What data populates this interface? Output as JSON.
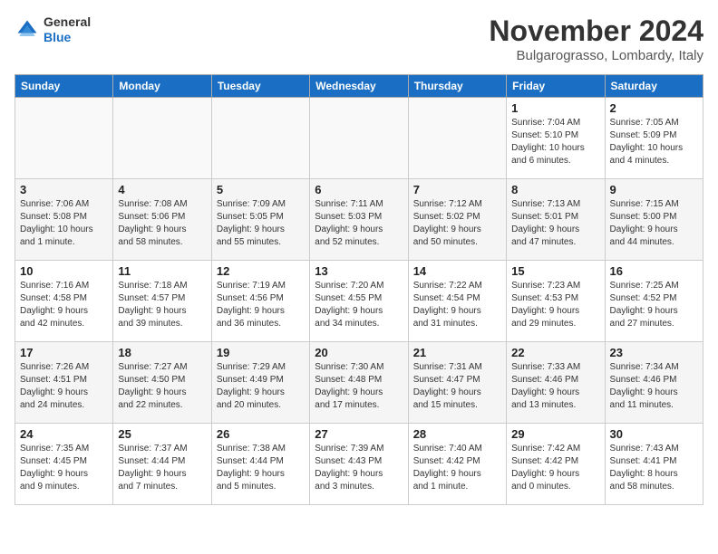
{
  "header": {
    "logo_line1": "General",
    "logo_line2": "Blue",
    "month_title": "November 2024",
    "location": "Bulgarograsso, Lombardy, Italy"
  },
  "weekdays": [
    "Sunday",
    "Monday",
    "Tuesday",
    "Wednesday",
    "Thursday",
    "Friday",
    "Saturday"
  ],
  "weeks": [
    {
      "shaded": false,
      "days": [
        {
          "num": "",
          "info": "",
          "empty": true
        },
        {
          "num": "",
          "info": "",
          "empty": true
        },
        {
          "num": "",
          "info": "",
          "empty": true
        },
        {
          "num": "",
          "info": "",
          "empty": true
        },
        {
          "num": "",
          "info": "",
          "empty": true
        },
        {
          "num": "1",
          "info": "Sunrise: 7:04 AM\nSunset: 5:10 PM\nDaylight: 10 hours\nand 6 minutes.",
          "empty": false
        },
        {
          "num": "2",
          "info": "Sunrise: 7:05 AM\nSunset: 5:09 PM\nDaylight: 10 hours\nand 4 minutes.",
          "empty": false
        }
      ]
    },
    {
      "shaded": true,
      "days": [
        {
          "num": "3",
          "info": "Sunrise: 7:06 AM\nSunset: 5:08 PM\nDaylight: 10 hours\nand 1 minute.",
          "empty": false
        },
        {
          "num": "4",
          "info": "Sunrise: 7:08 AM\nSunset: 5:06 PM\nDaylight: 9 hours\nand 58 minutes.",
          "empty": false
        },
        {
          "num": "5",
          "info": "Sunrise: 7:09 AM\nSunset: 5:05 PM\nDaylight: 9 hours\nand 55 minutes.",
          "empty": false
        },
        {
          "num": "6",
          "info": "Sunrise: 7:11 AM\nSunset: 5:03 PM\nDaylight: 9 hours\nand 52 minutes.",
          "empty": false
        },
        {
          "num": "7",
          "info": "Sunrise: 7:12 AM\nSunset: 5:02 PM\nDaylight: 9 hours\nand 50 minutes.",
          "empty": false
        },
        {
          "num": "8",
          "info": "Sunrise: 7:13 AM\nSunset: 5:01 PM\nDaylight: 9 hours\nand 47 minutes.",
          "empty": false
        },
        {
          "num": "9",
          "info": "Sunrise: 7:15 AM\nSunset: 5:00 PM\nDaylight: 9 hours\nand 44 minutes.",
          "empty": false
        }
      ]
    },
    {
      "shaded": false,
      "days": [
        {
          "num": "10",
          "info": "Sunrise: 7:16 AM\nSunset: 4:58 PM\nDaylight: 9 hours\nand 42 minutes.",
          "empty": false
        },
        {
          "num": "11",
          "info": "Sunrise: 7:18 AM\nSunset: 4:57 PM\nDaylight: 9 hours\nand 39 minutes.",
          "empty": false
        },
        {
          "num": "12",
          "info": "Sunrise: 7:19 AM\nSunset: 4:56 PM\nDaylight: 9 hours\nand 36 minutes.",
          "empty": false
        },
        {
          "num": "13",
          "info": "Sunrise: 7:20 AM\nSunset: 4:55 PM\nDaylight: 9 hours\nand 34 minutes.",
          "empty": false
        },
        {
          "num": "14",
          "info": "Sunrise: 7:22 AM\nSunset: 4:54 PM\nDaylight: 9 hours\nand 31 minutes.",
          "empty": false
        },
        {
          "num": "15",
          "info": "Sunrise: 7:23 AM\nSunset: 4:53 PM\nDaylight: 9 hours\nand 29 minutes.",
          "empty": false
        },
        {
          "num": "16",
          "info": "Sunrise: 7:25 AM\nSunset: 4:52 PM\nDaylight: 9 hours\nand 27 minutes.",
          "empty": false
        }
      ]
    },
    {
      "shaded": true,
      "days": [
        {
          "num": "17",
          "info": "Sunrise: 7:26 AM\nSunset: 4:51 PM\nDaylight: 9 hours\nand 24 minutes.",
          "empty": false
        },
        {
          "num": "18",
          "info": "Sunrise: 7:27 AM\nSunset: 4:50 PM\nDaylight: 9 hours\nand 22 minutes.",
          "empty": false
        },
        {
          "num": "19",
          "info": "Sunrise: 7:29 AM\nSunset: 4:49 PM\nDaylight: 9 hours\nand 20 minutes.",
          "empty": false
        },
        {
          "num": "20",
          "info": "Sunrise: 7:30 AM\nSunset: 4:48 PM\nDaylight: 9 hours\nand 17 minutes.",
          "empty": false
        },
        {
          "num": "21",
          "info": "Sunrise: 7:31 AM\nSunset: 4:47 PM\nDaylight: 9 hours\nand 15 minutes.",
          "empty": false
        },
        {
          "num": "22",
          "info": "Sunrise: 7:33 AM\nSunset: 4:46 PM\nDaylight: 9 hours\nand 13 minutes.",
          "empty": false
        },
        {
          "num": "23",
          "info": "Sunrise: 7:34 AM\nSunset: 4:46 PM\nDaylight: 9 hours\nand 11 minutes.",
          "empty": false
        }
      ]
    },
    {
      "shaded": false,
      "days": [
        {
          "num": "24",
          "info": "Sunrise: 7:35 AM\nSunset: 4:45 PM\nDaylight: 9 hours\nand 9 minutes.",
          "empty": false
        },
        {
          "num": "25",
          "info": "Sunrise: 7:37 AM\nSunset: 4:44 PM\nDaylight: 9 hours\nand 7 minutes.",
          "empty": false
        },
        {
          "num": "26",
          "info": "Sunrise: 7:38 AM\nSunset: 4:44 PM\nDaylight: 9 hours\nand 5 minutes.",
          "empty": false
        },
        {
          "num": "27",
          "info": "Sunrise: 7:39 AM\nSunset: 4:43 PM\nDaylight: 9 hours\nand 3 minutes.",
          "empty": false
        },
        {
          "num": "28",
          "info": "Sunrise: 7:40 AM\nSunset: 4:42 PM\nDaylight: 9 hours\nand 1 minute.",
          "empty": false
        },
        {
          "num": "29",
          "info": "Sunrise: 7:42 AM\nSunset: 4:42 PM\nDaylight: 9 hours\nand 0 minutes.",
          "empty": false
        },
        {
          "num": "30",
          "info": "Sunrise: 7:43 AM\nSunset: 4:41 PM\nDaylight: 8 hours\nand 58 minutes.",
          "empty": false
        }
      ]
    }
  ]
}
